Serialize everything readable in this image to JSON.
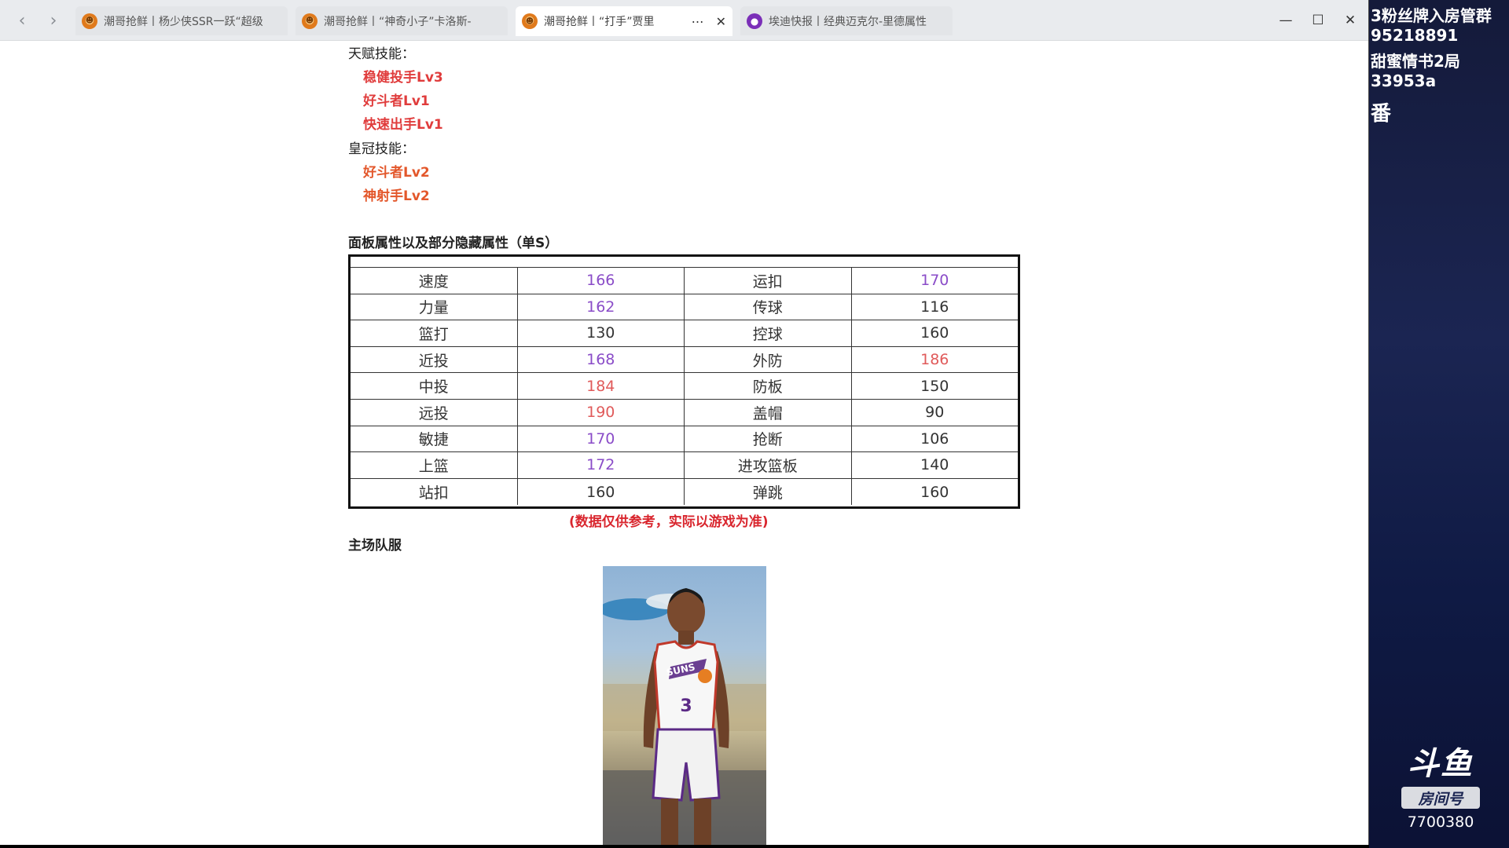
{
  "browser": {
    "tabs": [
      {
        "title": "潮哥抢鲜丨杨少侠SSR一跃“超级",
        "active": false,
        "icon": "orange-mascot-icon"
      },
      {
        "title": "潮哥抢鲜丨“神奇小子”卡洛斯-",
        "active": false,
        "icon": "orange-mascot-icon"
      },
      {
        "title": "潮哥抢鲜丨“打手”贾里",
        "active": true,
        "icon": "orange-mascot-icon"
      },
      {
        "title": "埃迪快报丨经典迈克尔-里德属性",
        "active": false,
        "icon": "purple-logo-icon"
      }
    ],
    "tab_more": "⋯",
    "tab_close": "✕",
    "controls": {
      "minimize": "—",
      "maximize": "☐",
      "close": "✕"
    },
    "nav": {
      "back": "‹",
      "forward": "›"
    }
  },
  "article": {
    "talent_heading": "天赋技能：",
    "talent_skills": [
      {
        "text": "稳健投手Lv3",
        "color": "#e03c3c"
      },
      {
        "text": "好斗者Lv1",
        "color": "#e03c3c"
      },
      {
        "text": "快速出手Lv1",
        "color": "#e03c3c"
      }
    ],
    "crown_heading": "皇冠技能：",
    "crown_skills": [
      {
        "text": "好斗者Lv2",
        "color": "#e3572b"
      },
      {
        "text": "神射手Lv2",
        "color": "#e3572b"
      }
    ],
    "stats_heading": "面板属性以及部分隐藏属性（单S）",
    "stats": [
      [
        {
          "t": "速度",
          "c": "#333"
        },
        {
          "t": "166",
          "c": "#8a4cc8"
        },
        {
          "t": "运扣",
          "c": "#333"
        },
        {
          "t": "170",
          "c": "#8a4cc8"
        }
      ],
      [
        {
          "t": "力量",
          "c": "#333"
        },
        {
          "t": "162",
          "c": "#8a4cc8"
        },
        {
          "t": "传球",
          "c": "#333"
        },
        {
          "t": "116",
          "c": "#333"
        }
      ],
      [
        {
          "t": "篮打",
          "c": "#333"
        },
        {
          "t": "130",
          "c": "#333"
        },
        {
          "t": "控球",
          "c": "#333"
        },
        {
          "t": "160",
          "c": "#333"
        }
      ],
      [
        {
          "t": "近投",
          "c": "#333"
        },
        {
          "t": "168",
          "c": "#8a4cc8"
        },
        {
          "t": "外防",
          "c": "#333"
        },
        {
          "t": "186",
          "c": "#e05a5a"
        }
      ],
      [
        {
          "t": "中投",
          "c": "#333"
        },
        {
          "t": "184",
          "c": "#e05a5a"
        },
        {
          "t": "防板",
          "c": "#333"
        },
        {
          "t": "150",
          "c": "#333"
        }
      ],
      [
        {
          "t": "远投",
          "c": "#333"
        },
        {
          "t": "190",
          "c": "#e05a5a"
        },
        {
          "t": "盖帽",
          "c": "#333"
        },
        {
          "t": "90",
          "c": "#333"
        }
      ],
      [
        {
          "t": "敏捷",
          "c": "#333"
        },
        {
          "t": "170",
          "c": "#8a4cc8"
        },
        {
          "t": "抢断",
          "c": "#333"
        },
        {
          "t": "106",
          "c": "#333"
        }
      ],
      [
        {
          "t": "上篮",
          "c": "#333"
        },
        {
          "t": "172",
          "c": "#8a4cc8"
        },
        {
          "t": "进攻篮板",
          "c": "#333"
        },
        {
          "t": "140",
          "c": "#333"
        }
      ],
      [
        {
          "t": "站扣",
          "c": "#333"
        },
        {
          "t": "160",
          "c": "#333"
        },
        {
          "t": "弹跳",
          "c": "#333"
        },
        {
          "t": "160",
          "c": "#333"
        }
      ]
    ],
    "note": "(数据仅供参考，实际以游戏为准)",
    "home_jersey_heading": "主场队服",
    "jersey_text": "SUNS",
    "jersey_number": "3"
  },
  "overlay": {
    "lines": [
      "3粉丝牌入房管群",
      "95218891",
      "甜蜜情书2局",
      "33953a",
      "番"
    ],
    "logo_text": "斗鱼",
    "room_label": "房间号",
    "room_number": "7700380"
  }
}
